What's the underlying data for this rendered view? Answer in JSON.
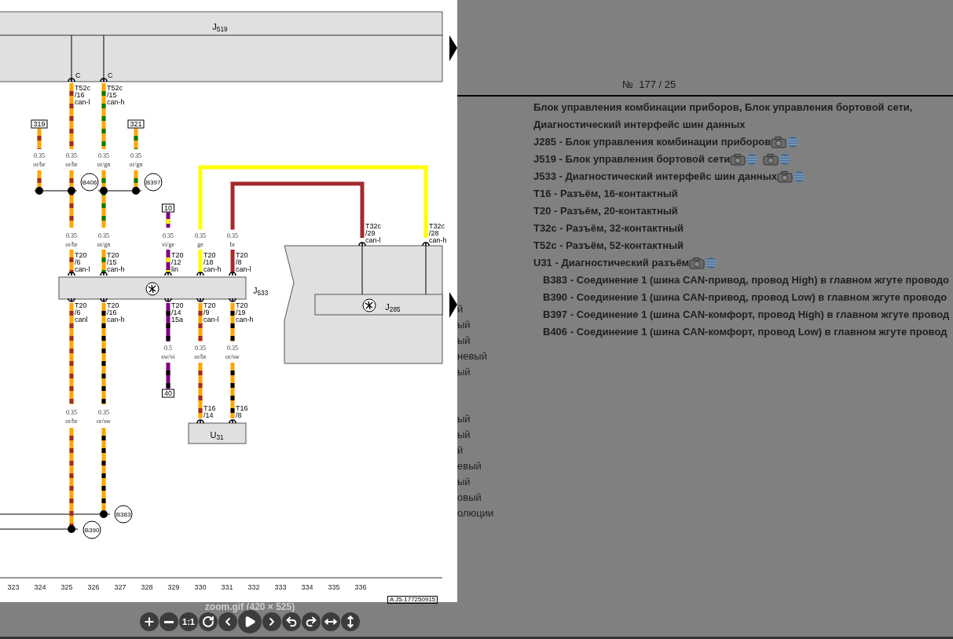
{
  "diagram": {
    "components": [
      {
        "label": "J$_{519}$"
      },
      {
        "label": "J$_{533}$"
      },
      {
        "label": "J$_{285}$"
      },
      {
        "label": "U$_{31}$"
      }
    ],
    "connector_marks": [
      "C",
      "C"
    ],
    "wires": [
      {
        "color": "#ffa500",
        "stripe": {
          "color": "#a52a2a"
        }
      },
      {
        "color": "#ffa500",
        "stripe": {
          "color": "#008000"
        }
      },
      {
        "color": "#ffa500",
        "stripe": {
          "color": "#a52a2a"
        }
      },
      {
        "color": "#ffa500",
        "stripe": {
          "color": "#008000"
        }
      },
      {
        "color": "#ffa500",
        "stripe": {
          "color": "#a52a2a"
        }
      },
      {
        "color": "#ffa500",
        "stripe": {
          "color": "#a52a2a"
        }
      },
      {
        "color": "#ffa500",
        "stripe": {
          "color": "#008000"
        }
      },
      {
        "color": "#ffa500",
        "stripe": {
          "color": "#008000"
        }
      },
      {
        "color": "#ffa500",
        "stripe": {
          "color": "#a52a2a"
        }
      },
      {
        "color": "#ffa500",
        "stripe": {
          "color": "#008000"
        }
      },
      {
        "color": "#800080",
        "stripe": {
          "color": "#ffff00"
        }
      },
      {
        "color": "#800080",
        "stripe": {
          "color": "#ffff00"
        }
      },
      {
        "color": "#ffff00"
      },
      {
        "color": "#a52a2a"
      },
      {
        "color": "#ffff00"
      },
      {
        "color": "#a52a2a"
      },
      {
        "color": "#ffa500",
        "stripe": {
          "color": "#a52a2a"
        }
      },
      {
        "color": "#ffa500",
        "stripe": {
          "color": "#000000"
        }
      },
      {
        "color": "#800080",
        "stripe": {
          "color": "#000000"
        }
      },
      {
        "color": "#ffa500",
        "stripe": {
          "color": "#a52a2a"
        }
      },
      {
        "color": "#ffa500",
        "stripe": {
          "color": "#000000"
        }
      },
      {
        "color": "#800080",
        "stripe": {
          "color": "#000000"
        }
      },
      {
        "color": "#ffa500",
        "stripe": {
          "color": "#a52a2a"
        }
      },
      {
        "color": "#ffa500",
        "stripe": {
          "color": "#000000"
        }
      },
      {
        "color": "#ffa500",
        "stripe": {
          "color": "#a52a2a"
        }
      },
      {
        "color": "#ffa500",
        "stripe": {
          "color": "#000000"
        }
      }
    ],
    "pins": [
      {
        "lines": [
          "T52c",
          "/16",
          "can-l"
        ]
      },
      {
        "lines": [
          "T52c",
          "/15",
          "can-h"
        ]
      },
      {
        "lines": [
          "T20",
          "/6",
          "can-l"
        ]
      },
      {
        "lines": [
          "T20",
          "/15",
          "can-h"
        ]
      },
      {
        "lines": [
          "T20",
          "/12",
          "lin"
        ]
      },
      {
        "lines": [
          "T20",
          "/18",
          "can-h"
        ]
      },
      {
        "lines": [
          "T20",
          "/8",
          "can-l"
        ]
      },
      {
        "lines": [
          "T32c",
          "/29",
          "can-l"
        ]
      },
      {
        "lines": [
          "T32c",
          "/28",
          "can-h"
        ]
      },
      {
        "lines": [
          "T20",
          "/6",
          "canl"
        ]
      },
      {
        "lines": [
          "T20",
          "/16",
          "can-h"
        ]
      },
      {
        "lines": [
          "T20",
          "/14",
          "15a"
        ]
      },
      {
        "lines": [
          "T20",
          "/9",
          "can-l"
        ]
      },
      {
        "lines": [
          "T20",
          "/19",
          "can-h"
        ]
      },
      {
        "lines": [
          "T16",
          "/14"
        ]
      },
      {
        "lines": [
          "T16",
          "/8"
        ]
      }
    ],
    "gauges": [
      {
        "size": "0.35",
        "colors": "or/br"
      },
      {
        "size": "0.35",
        "colors": "or/br"
      },
      {
        "size": "0.35",
        "colors": "or/gn"
      },
      {
        "size": "0.35",
        "colors": "or/gn"
      },
      {
        "size": "0.35",
        "colors": "or/br"
      },
      {
        "size": "0.35",
        "colors": "or/gn"
      },
      {
        "size": "0.35",
        "colors": "vi/ge"
      },
      {
        "size": "0.35",
        "colors": "ge"
      },
      {
        "size": "0.35",
        "colors": "br"
      },
      {
        "size": "0.5",
        "colors": "sw/vi"
      },
      {
        "size": "0.35",
        "colors": "or/br"
      },
      {
        "size": "0.35",
        "colors": "or/sw"
      },
      {
        "size": "0.35",
        "colors": "or/br"
      },
      {
        "size": "0.35",
        "colors": "or/sw"
      }
    ],
    "terminals": [
      "319",
      "321",
      "10",
      "40"
    ],
    "splices": [
      "B406",
      "B397",
      "B383",
      "B390"
    ],
    "columns": [
      "323",
      "324",
      "325",
      "326",
      "327",
      "328",
      "329",
      "330",
      "331",
      "332",
      "333",
      "334",
      "335",
      "336"
    ],
    "document_id": "A J5-177250915"
  },
  "fragment_groups": [
    [
      "й",
      "ый",
      "ый",
      "невый",
      "ый"
    ],
    [
      "ый",
      "ый",
      "й",
      "евый",
      "ый",
      "овый",
      "олюции"
    ]
  ],
  "info": {
    "number": "№  177 / 25",
    "title": "Блок управления комбинации приборов, Блок управления бортовой сети, Диагностический интерфейс шин данных",
    "legend": [
      {
        "kind": "component",
        "text": "J285 - Блок управления комбинации приборов",
        "links": [
          {
            "kind": "photo"
          },
          {
            "kind": "globe"
          }
        ]
      },
      {
        "kind": "component",
        "text": "J519 - Блок управления бортовой сети",
        "links": [
          {
            "kind": "photo"
          },
          {
            "kind": "globe"
          },
          {
            "kind": "photo"
          },
          {
            "kind": "globe"
          }
        ]
      },
      {
        "kind": "component",
        "text": "J533 - Диагностический интерфейс шин данных",
        "links": [
          {
            "kind": "photo"
          },
          {
            "kind": "globe"
          }
        ]
      },
      {
        "kind": "component",
        "text": "T16 - Разъём, 16-контактный"
      },
      {
        "kind": "component",
        "text": "T20 - Разъём, 20-контактный"
      },
      {
        "kind": "component",
        "text": "T32c - Разъём, 32-контактный"
      },
      {
        "kind": "component",
        "text": "T52c - Разъём, 52-контактный"
      },
      {
        "kind": "component",
        "text": "U31 - Диагностический разъём",
        "links": [
          {
            "kind": "photo"
          },
          {
            "kind": "globe"
          }
        ]
      },
      {
        "kind": "splice",
        "text": "B383 - Соединение 1 (шина CAN-привод, провод High) в главном жгуте проводо"
      },
      {
        "kind": "splice",
        "text": "B390 - Соединение 1 (шина CAN-привод, провод Low) в главном жгуте проводо"
      },
      {
        "kind": "splice",
        "text": "B397 - Соединение 1 (шина CAN-комфорт, провод High) в главном жгуте провод"
      },
      {
        "kind": "splice",
        "text": "B406 - Соединение 1 (шина CAN-комфорт, провод Low) в главном жгуте провод"
      }
    ]
  },
  "viewer": {
    "caption": "zoom.gif (420 × 525)",
    "toolbar": [
      {
        "kind": "zoom-in"
      },
      {
        "kind": "zoom-out"
      },
      {
        "kind": "text",
        "label": "1:1"
      },
      {
        "kind": "rotate"
      },
      {
        "kind": "previous"
      },
      {
        "kind": "play"
      },
      {
        "kind": "next"
      },
      {
        "kind": "undo"
      },
      {
        "kind": "redo"
      },
      {
        "kind": "fit-width"
      },
      {
        "kind": "fit-height"
      }
    ]
  }
}
